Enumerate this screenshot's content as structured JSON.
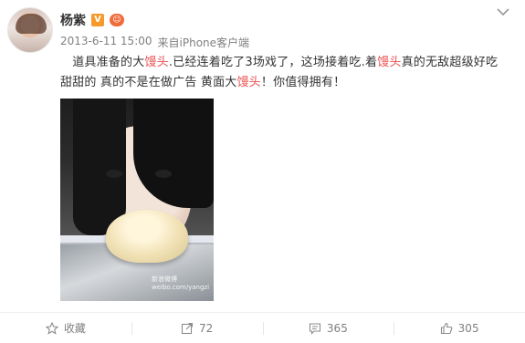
{
  "user": {
    "name": "杨紫",
    "verified_badge": "V",
    "vip_badge": "☺"
  },
  "meta": {
    "date": "2013-6-11 15:00",
    "source_prefix": "来自",
    "source": "iPhone客户端"
  },
  "post": {
    "segments": [
      {
        "text": "　道具准备的大"
      },
      {
        "text": "馒头",
        "highlight": true
      },
      {
        "text": ".已经连着吃了3场戏了，这场接着吃.着"
      },
      {
        "text": "馒头",
        "highlight": true
      },
      {
        "text": "真的无敌超级好吃 甜甜的 真的不是在做广告 黄面大"
      },
      {
        "text": "馒头",
        "highlight": true
      },
      {
        "text": "！你值得拥有！"
      }
    ],
    "image_watermark": "新浪微博\nweibo.com/yangzi",
    "highlight_color": "#eb4f4f"
  },
  "actions": {
    "favorite_label": "收藏",
    "repost_count": "72",
    "comment_count": "365",
    "like_count": "305"
  },
  "icons": {
    "more": "chevron-down-icon",
    "favorite": "star-icon",
    "repost": "repost-icon",
    "comment": "comment-icon",
    "like": "thumbs-up-icon"
  }
}
